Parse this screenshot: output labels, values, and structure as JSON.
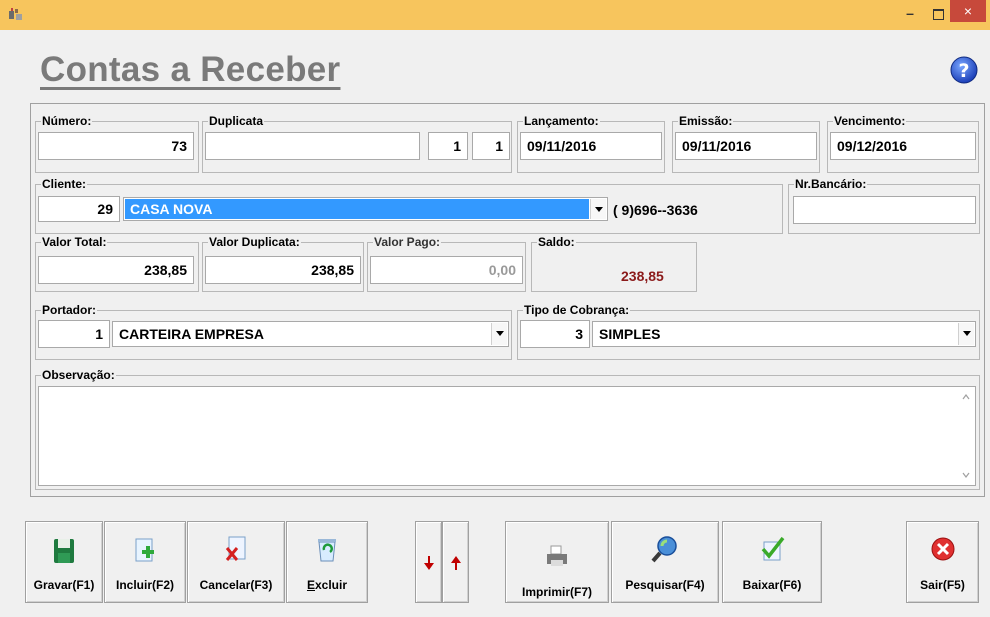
{
  "window": {
    "min_glyph": "–",
    "close_glyph": "×"
  },
  "page_title": "Contas a Receber",
  "fields": {
    "numero": {
      "label": "Número:",
      "value": "73"
    },
    "duplicata": {
      "label": "Duplicata",
      "value": "",
      "parcela": "1",
      "total_parcelas": "1"
    },
    "lancamento": {
      "label": "Lançamento:",
      "value": "09/11/2016"
    },
    "emissao": {
      "label": "Emissão:",
      "value": "09/11/2016"
    },
    "vencimento": {
      "label": "Vencimento:",
      "value": "09/12/2016"
    },
    "cliente": {
      "label": "Cliente:",
      "code": "29",
      "name": "CASA NOVA",
      "phone": "( 9)696--3636"
    },
    "nr_bancario": {
      "label": "Nr.Bancário:",
      "value": ""
    },
    "valor_total": {
      "label": "Valor Total:",
      "value": "238,85"
    },
    "valor_duplicata": {
      "label": "Valor Duplicata:",
      "value": "238,85"
    },
    "valor_pago": {
      "label": "Valor Pago:",
      "value": "0,00"
    },
    "saldo": {
      "label": "Saldo:",
      "value": "238,85",
      "color": "#8b1a1a"
    },
    "portador": {
      "label": "Portador:",
      "code": "1",
      "name": "CARTEIRA EMPRESA"
    },
    "tipo_cobranca": {
      "label": "Tipo de Cobrança:",
      "code": "3",
      "name": "SIMPLES"
    },
    "observacao": {
      "label": "Observação:",
      "value": ""
    }
  },
  "toolbar": {
    "gravar": "Gravar(F1)",
    "incluir": "Incluir(F2)",
    "cancelar": "Cancelar(F3)",
    "excluir_u": "E",
    "excluir_rest": "xcluir",
    "imprimir": "Imprimir(F7)",
    "pesquisar": "Pesquisar(F4)",
    "baixar": "Baixar(F6)",
    "sair": "Sair(F5)"
  },
  "icons": {
    "app": "app-icon",
    "help": "help-icon",
    "gravar": "floppy-disk-icon",
    "incluir": "add-document-icon",
    "cancelar": "cancel-document-icon",
    "excluir": "recycle-bin-icon",
    "down": "arrow-down-icon",
    "up": "arrow-up-icon",
    "imprimir": "printer-icon",
    "pesquisar": "magnifier-icon",
    "baixar": "checkmark-document-icon",
    "sair": "exit-icon"
  },
  "colors": {
    "titlebar": "#f7c55d",
    "close_button": "#c7493b",
    "selection": "#3399ff",
    "title_text": "#7a7a7a"
  }
}
